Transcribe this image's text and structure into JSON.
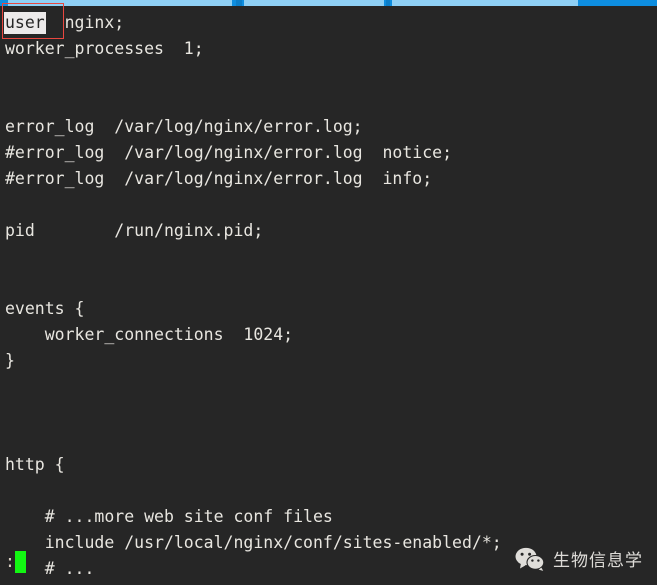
{
  "window": {
    "background_color": "#262626",
    "foreground_color": "#e8e6e0",
    "topbar_color": "#0e8ee0"
  },
  "editor": {
    "app": "vim",
    "file_kind": "nginx.conf",
    "lines": [
      {
        "id": "l1",
        "prefix": "",
        "highlight": "user",
        "suffix": "  nginx;"
      },
      {
        "id": "l2",
        "text": "worker_processes  1;"
      },
      {
        "id": "l3",
        "text": ""
      },
      {
        "id": "l4",
        "text": ""
      },
      {
        "id": "l5",
        "text": "error_log  /var/log/nginx/error.log;"
      },
      {
        "id": "l6",
        "text": "#error_log  /var/log/nginx/error.log  notice;"
      },
      {
        "id": "l7",
        "text": "#error_log  /var/log/nginx/error.log  info;"
      },
      {
        "id": "l8",
        "text": ""
      },
      {
        "id": "l9",
        "text": "pid        /run/nginx.pid;"
      },
      {
        "id": "l10",
        "text": ""
      },
      {
        "id": "l11",
        "text": ""
      },
      {
        "id": "l12",
        "text": "events {"
      },
      {
        "id": "l13",
        "text": "    worker_connections  1024;"
      },
      {
        "id": "l14",
        "text": "}"
      },
      {
        "id": "l15",
        "text": ""
      },
      {
        "id": "l16",
        "text": ""
      },
      {
        "id": "l17",
        "text": ""
      },
      {
        "id": "l18",
        "text": "http {"
      },
      {
        "id": "l19",
        "text": ""
      },
      {
        "id": "l20",
        "text": "    # ...more web site conf files"
      },
      {
        "id": "l21",
        "text": "    include /usr/local/nginx/conf/sites-enabled/*;"
      },
      {
        "id": "l22",
        "text": "    # ..."
      }
    ],
    "search_match": {
      "term": "user",
      "highlight_bg": "#eceaea",
      "highlight_fg": "#262626"
    },
    "command_line": {
      "prompt": ":",
      "value": "",
      "cursor_color": "#12f712"
    }
  },
  "annotation": {
    "type": "rectangle",
    "color": "#e8473f",
    "target": "user"
  },
  "watermark": {
    "icon": "wechat-icon",
    "text": "生物信息学"
  }
}
